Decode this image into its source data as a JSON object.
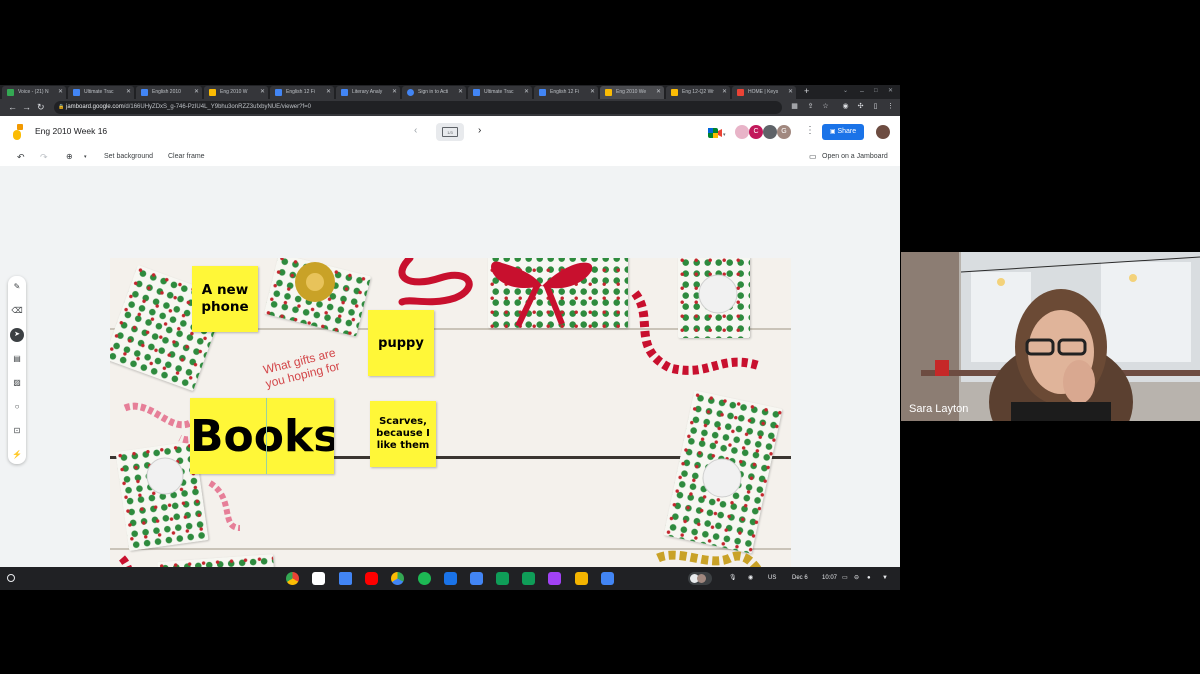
{
  "browser": {
    "tabs": [
      {
        "label": "Voice - (21) N",
        "color": "#34a853"
      },
      {
        "label": "Ultimate Trac",
        "color": "#4285f4"
      },
      {
        "label": "English 2010",
        "color": "#4285f4"
      },
      {
        "label": "Eng 2010 W",
        "color": "#fbbc04"
      },
      {
        "label": "English 12 Fi",
        "color": "#4285f4"
      },
      {
        "label": "Literary Analy",
        "color": "#4285f4"
      },
      {
        "label": "Sign in to Acti",
        "color": "#4285f4"
      },
      {
        "label": "Ultimate Trac",
        "color": "#4285f4"
      },
      {
        "label": "English 12 Fi",
        "color": "#4285f4"
      },
      {
        "label": "Eng 2010 We",
        "color": "#fbbc04"
      },
      {
        "label": "Eng 12-Q2 Wr",
        "color": "#fbbc04"
      },
      {
        "label": "HOME | Keys",
        "color": "#ea4335"
      }
    ],
    "url_host": "jamboard.google.com",
    "url_path": "/d/166UHyZDxS_g-746-PzIU4L_Y9bhu3onRZZ3ufxbyNUE/viewer?f=0"
  },
  "jamboard": {
    "title": "Eng 2010 Week 16",
    "frame_counter": "1/3",
    "share_label": "Share",
    "avatars": [
      "",
      "C",
      "",
      "G"
    ],
    "toolbar": {
      "set_background": "Set background",
      "clear_frame": "Clear frame",
      "open_on_jamboard": "Open on a Jamboard"
    },
    "sticky_notes": [
      "A new phone",
      "puppy",
      "Books",
      "Scarves, because I like them"
    ],
    "frame_text": "What gifts are you hoping for"
  },
  "shelf": {
    "date": "Dec 6",
    "time": "10:07",
    "lang": "US"
  },
  "video": {
    "participant_name": "Sara Layton"
  },
  "colors": {
    "share_blue": "#1a73e8",
    "sticky_yellow": "#fff738",
    "ribbon_red": "#c8102e",
    "holly_green": "#2e8b3e",
    "gold": "#c9a227"
  }
}
